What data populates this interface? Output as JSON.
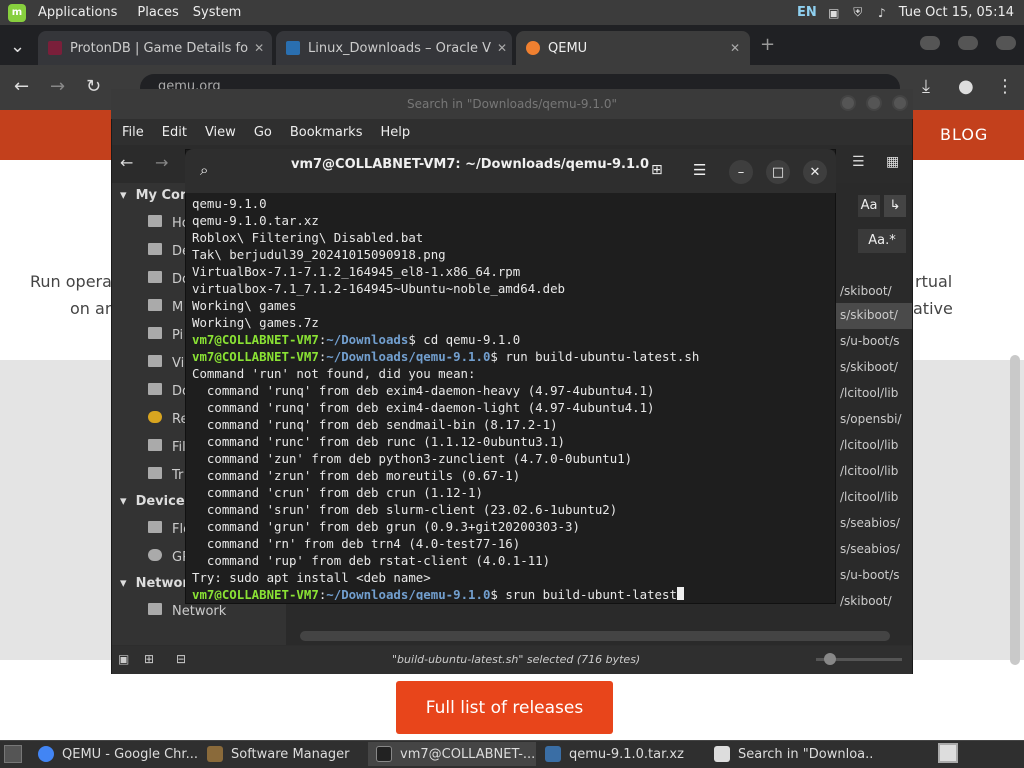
{
  "top_panel": {
    "menus": [
      "Applications",
      "Places",
      "System"
    ],
    "keyboard": "EN",
    "datetime": "Tue Oct 15, 05:14"
  },
  "browser": {
    "tabs": [
      {
        "label": "ProtonDB | Game Details fo",
        "color": "#7a1f3a"
      },
      {
        "label": "Linux_Downloads – Oracle V",
        "color": "#2a6fb0"
      },
      {
        "label": "QEMU",
        "color": "#f08030"
      }
    ],
    "url": "qemu.org",
    "blog_label": "BLOG",
    "page_text_left_1": "Run operat",
    "page_text_left_2": "on an",
    "page_text_right_1": "rtual",
    "page_text_right_2": "ative",
    "releases_button": "Full list of releases"
  },
  "file_manager": {
    "title": "Search in \"Downloads/qemu-9.1.0\"",
    "menu": [
      "File",
      "Edit",
      "View",
      "Go",
      "Bookmarks",
      "Help"
    ],
    "sidebar_sections": [
      "My Com",
      "Devices",
      "Networ"
    ],
    "sidebar_items": [
      "Ho",
      "De",
      "Do",
      "M",
      "Pi",
      "Vi",
      "Do",
      "Re",
      "Fil",
      "Tr"
    ],
    "device_items": [
      "Flo",
      "GP"
    ],
    "network_item": "Network",
    "path_rows": [
      "/skiboot/",
      "s/skiboot/",
      "s/u-boot/s",
      "s/skiboot/",
      "/lcitool/lib",
      "s/opensbi/",
      "/lcitool/lib",
      "/lcitool/lib",
      "/lcitool/lib",
      "s/seabios/",
      "s/seabios/",
      "s/u-boot/s",
      "/skiboot/"
    ],
    "status": "\"build-ubuntu-latest.sh\" selected (716 bytes)",
    "search_aa": "Aa",
    "search_regex": "Aa.*"
  },
  "terminal": {
    "title": "vm7@COLLABNET-VM7: ~/Downloads/qemu-9.1.0",
    "lines": [
      "qemu-9.1.0",
      "qemu-9.1.0.tar.xz",
      "Roblox\\ Filtering\\ Disabled.bat",
      "Tak\\ berjudul39_20241015090918.png",
      "VirtualBox-7.1-7.1.2_164945_el8-1.x86_64.rpm",
      "virtualbox-7.1_7.1.2-164945~Ubuntu~noble_amd64.deb",
      "Working\\ games",
      "Working\\ games.7z"
    ],
    "prompt_user": "vm7@COLLABNET-VM7",
    "prompt_path_1": "~/Downloads",
    "command_1": "$ cd qemu-9.1.0",
    "prompt_path_2": "~/Downloads/qemu-9.1.0",
    "command_2": "$ run build-ubuntu-latest.sh",
    "output": [
      "Command 'run' not found, did you mean:",
      "  command 'runq' from deb exim4-daemon-heavy (4.97-4ubuntu4.1)",
      "  command 'runq' from deb exim4-daemon-light (4.97-4ubuntu4.1)",
      "  command 'runq' from deb sendmail-bin (8.17.2-1)",
      "  command 'runc' from deb runc (1.1.12-0ubuntu3.1)",
      "  command 'zun' from deb python3-zunclient (4.7.0-0ubuntu1)",
      "  command 'zrun' from deb moreutils (0.67-1)",
      "  command 'crun' from deb crun (1.12-1)",
      "  command 'srun' from deb slurm-client (23.02.6-1ubuntu2)",
      "  command 'grun' from deb grun (0.9.3+git20200303-3)",
      "  command 'rn' from deb trn4 (4.0-test77-16)",
      "  command 'rup' from deb rstat-client (4.0.1-11)",
      "Try: sudo apt install <deb name>"
    ],
    "prompt_path_3": "~/Downloads/qemu-9.1.0",
    "command_3": "$ srun build-ubunt-latest"
  },
  "taskbar": [
    {
      "label": "QEMU - Google Chr...",
      "color": "#4285f4"
    },
    {
      "label": "Software Manager",
      "color": "#8a6a3a"
    },
    {
      "label": "vm7@COLLABNET-...",
      "color": "#222222"
    },
    {
      "label": "qemu-9.1.0.tar.xz",
      "color": "#3a6ea5"
    },
    {
      "label": "Search in \"Downloa...",
      "color": "#dddddd"
    }
  ]
}
